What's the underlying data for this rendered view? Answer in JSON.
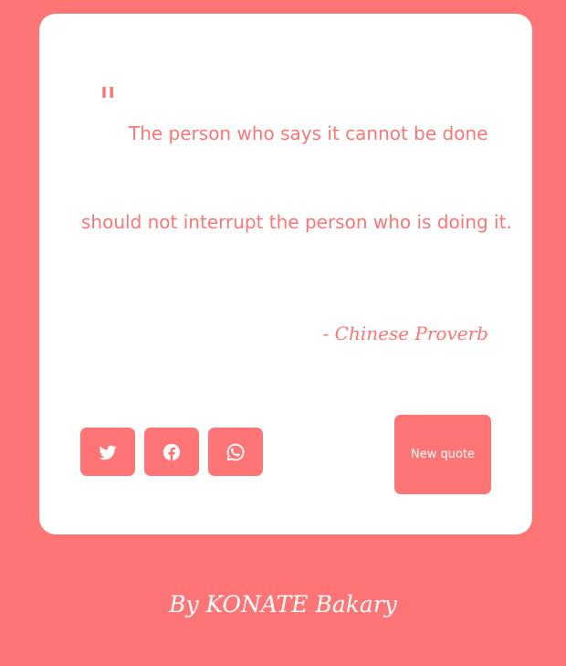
{
  "quote": {
    "mark": "\"",
    "line1": "The person who says it cannot be done",
    "line2": "should not interrupt the person who is doing it.",
    "author": "- Chinese Proverb"
  },
  "share": {
    "icons": [
      "twitter-icon",
      "facebook-icon",
      "whatsapp-icon"
    ]
  },
  "actions": {
    "new_quote_label": "New quote"
  },
  "footer": {
    "credit": "By KONATE Bakary"
  },
  "colors": {
    "background": "#ff7575",
    "card": "#ffffff",
    "accent": "#ff7575",
    "button_text": "#ffffff"
  }
}
